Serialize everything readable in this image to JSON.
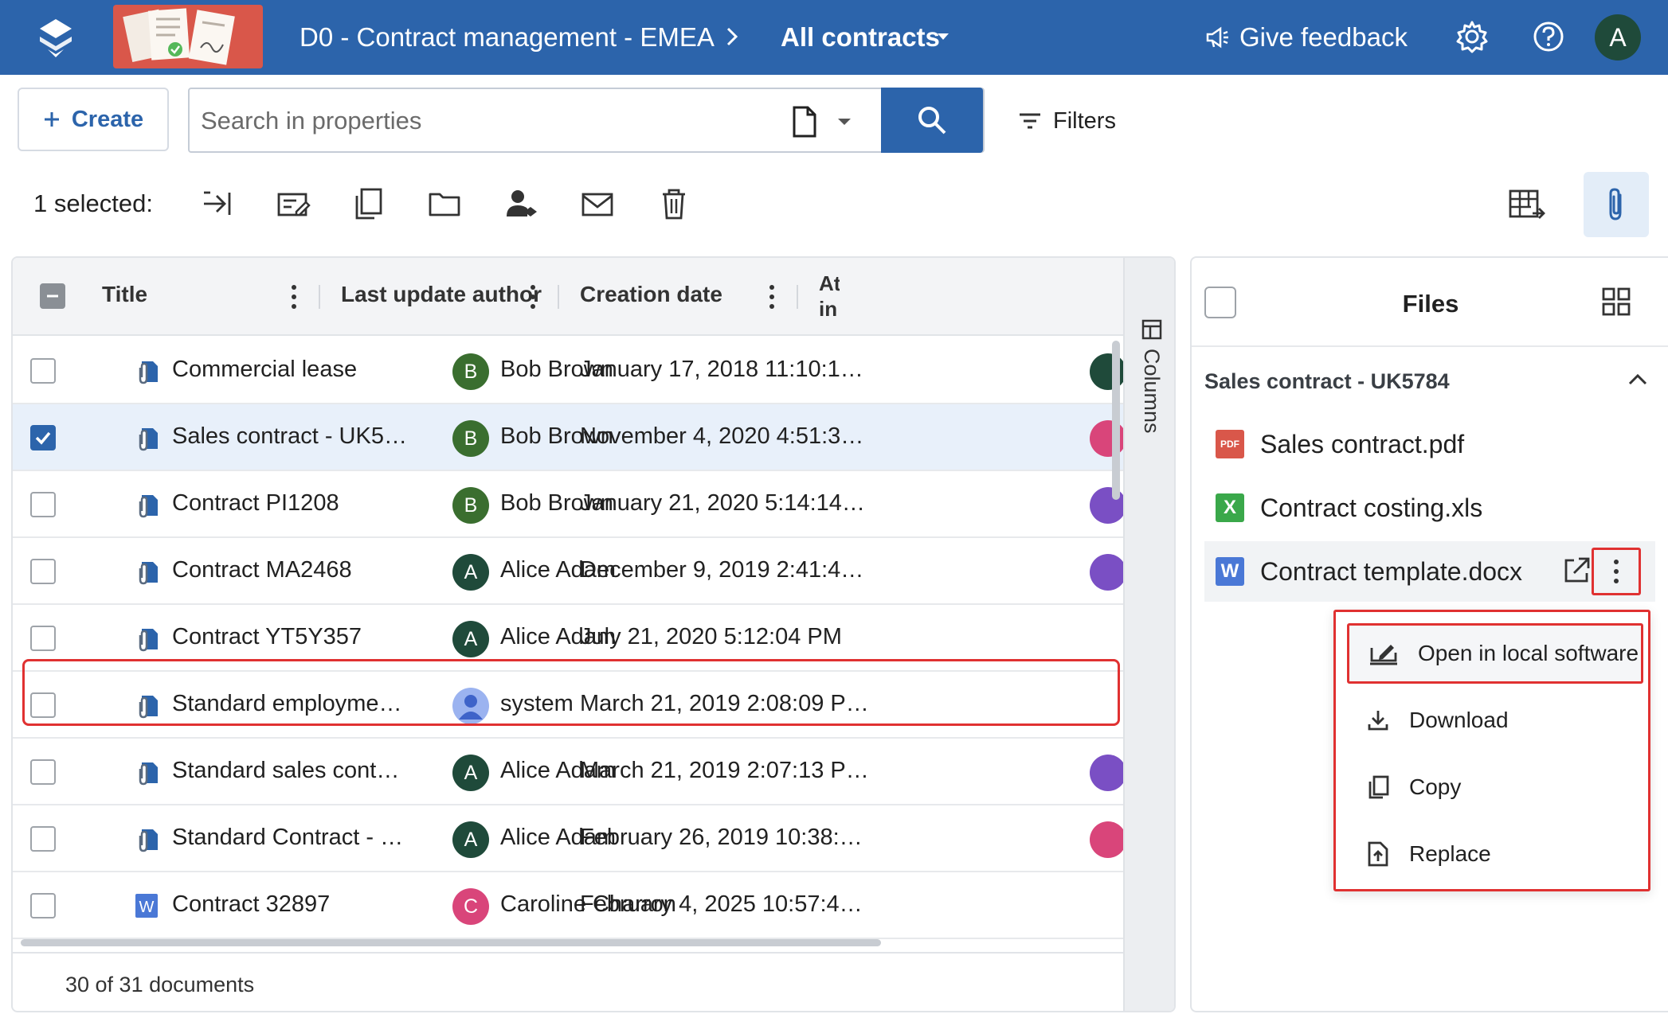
{
  "header": {
    "breadcrumb_workspace": "D0 - Contract management - EMEA",
    "breadcrumb_view": "All contracts",
    "feedback_label": "Give feedback",
    "user_initial": "A",
    "brand_color": "#2c64ab"
  },
  "toolbar": {
    "create_label": "Create",
    "search_placeholder": "Search in properties",
    "filters_label": "Filters",
    "selected_label": "1 selected:",
    "actions": [
      "share-icon",
      "edit-properties-icon",
      "copy-icon",
      "folder-icon",
      "assign-user-icon",
      "email-icon",
      "delete-icon"
    ]
  },
  "grid": {
    "columns": [
      "Title",
      "Last update author",
      "Creation date",
      "Atta in c"
    ],
    "rows": [
      {
        "title": "Commercial lease",
        "author": "Bob Brown",
        "initial": "B",
        "avatar_color": "#3a6e2f",
        "date": "January 17, 2018 11:10:1…",
        "checked": false,
        "type": "contract",
        "edge_color": "#1f4a3a"
      },
      {
        "title": "Sales contract - UK5…",
        "author": "Bob Brown",
        "initial": "B",
        "avatar_color": "#3a6e2f",
        "date": "November 4, 2020 4:51:3…",
        "checked": true,
        "type": "contract",
        "edge_color": "#d9457a"
      },
      {
        "title": "Contract PI1208",
        "author": "Bob Brown",
        "initial": "B",
        "avatar_color": "#3a6e2f",
        "date": "January 21, 2020 5:14:14…",
        "checked": false,
        "type": "contract",
        "edge_color": "#7a4fc4"
      },
      {
        "title": "Contract MA2468",
        "author": "Alice Adam",
        "initial": "A",
        "avatar_color": "#1f4a3a",
        "date": "December 9, 2019 2:41:4…",
        "checked": false,
        "type": "contract",
        "edge_color": "#7a4fc4"
      },
      {
        "title": "Contract YT5Y357",
        "author": "Alice Adam",
        "initial": "A",
        "avatar_color": "#1f4a3a",
        "date": "July 21, 2020 5:12:04 PM",
        "checked": false,
        "type": "contract",
        "edge_color": ""
      },
      {
        "title": "Standard employme…",
        "author": "system",
        "initial": "",
        "avatar_color": "#9bb3f0",
        "date": "March 21, 2019 2:08:09 P…",
        "checked": false,
        "type": "contract",
        "edge_color": ""
      },
      {
        "title": "Standard sales cont…",
        "author": "Alice Adam",
        "initial": "A",
        "avatar_color": "#1f4a3a",
        "date": "March 21, 2019 2:07:13 P…",
        "checked": false,
        "type": "contract",
        "edge_color": "#7a4fc4"
      },
      {
        "title": "Standard Contract - …",
        "author": "Alice Adam",
        "initial": "A",
        "avatar_color": "#1f4a3a",
        "date": "February 26, 2019 10:38:…",
        "checked": false,
        "type": "contract",
        "edge_color": "#d9457a"
      },
      {
        "title": "Contract 32897",
        "author": "Caroline Charron",
        "initial": "C",
        "avatar_color": "#d9457a",
        "date": "February 4, 2025 10:57:4…",
        "checked": false,
        "type": "word",
        "edge_color": ""
      }
    ],
    "columns_rail_label": "Columns",
    "footer_count": "30 of 31 documents"
  },
  "files_panel": {
    "title": "Files",
    "group_title": "Sales contract - UK5784",
    "files": [
      {
        "name": "Sales contract.pdf",
        "badge": "PDF",
        "badge_color": "#d9574a"
      },
      {
        "name": "Contract costing.xls",
        "badge": "X",
        "badge_color": "#3aa84a"
      },
      {
        "name": "Contract template.docx",
        "badge": "W",
        "badge_color": "#4a78d6"
      }
    ],
    "menu": [
      "Open in local software",
      "Download",
      "Copy",
      "Replace"
    ]
  }
}
